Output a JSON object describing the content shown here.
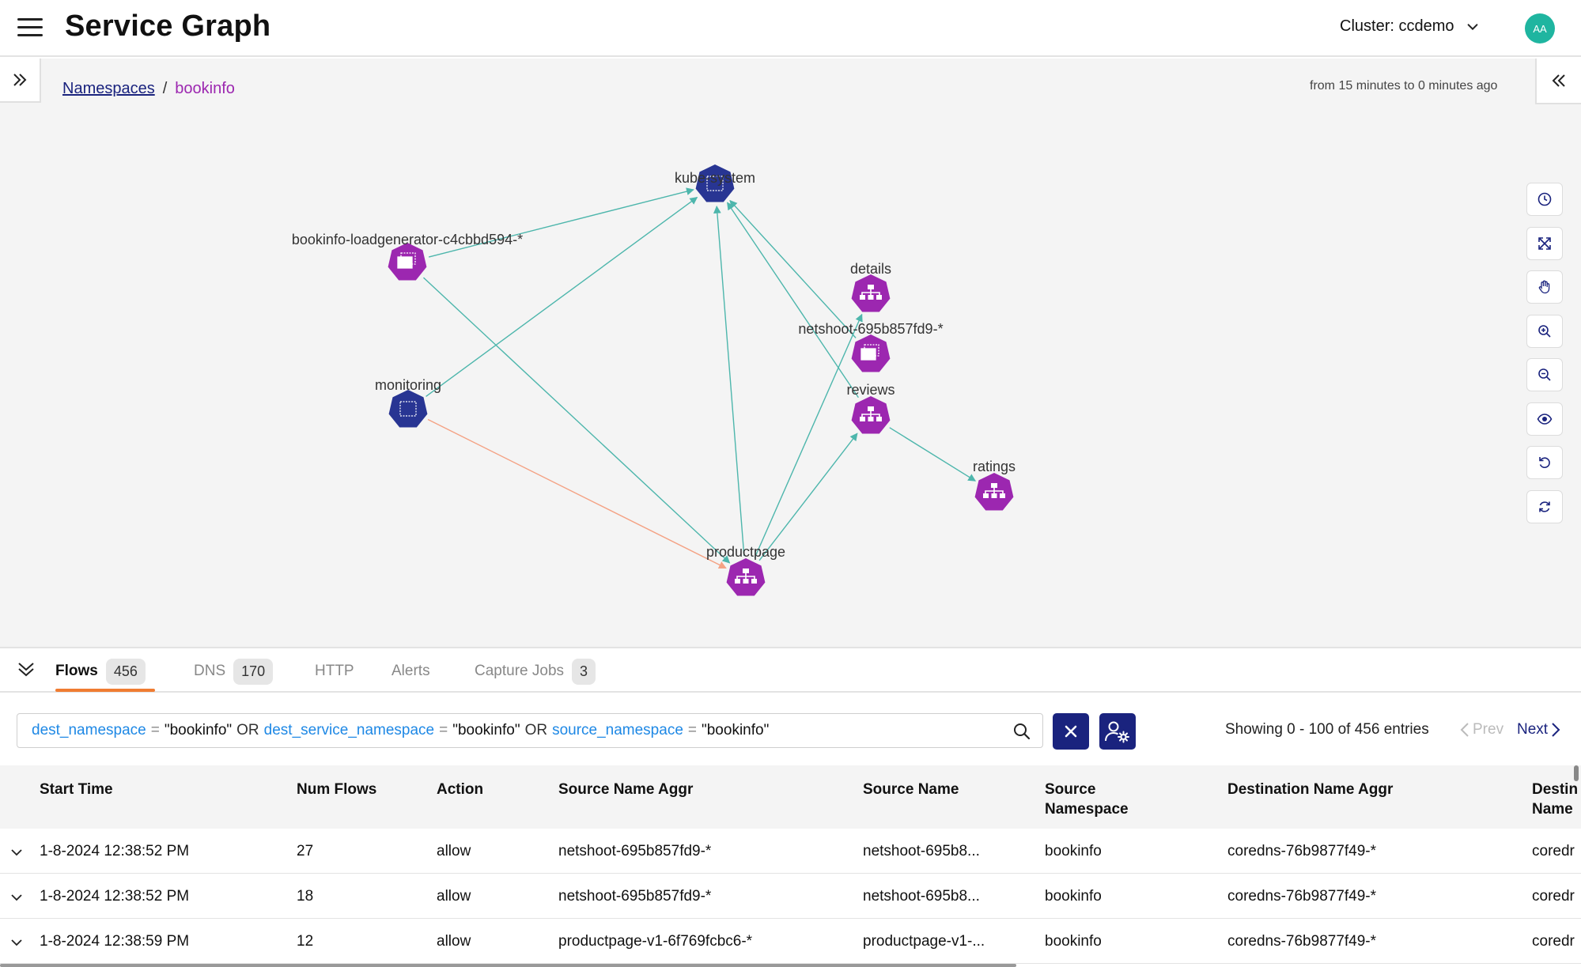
{
  "header": {
    "title": "Service Graph",
    "cluster_label": "Cluster: ccdemo",
    "avatar_initials": "AA"
  },
  "breadcrumb": {
    "root": "Namespaces",
    "separator": "/",
    "current": "bookinfo"
  },
  "time_range": "from 15 minutes to 0 minutes ago",
  "graph": {
    "node_colors": {
      "namespace": "#283593",
      "workload": "#9c27b0",
      "edge_allow": "#4db6ac",
      "edge_deny": "#f4a284"
    },
    "nodes": [
      {
        "id": "kube-system",
        "label": "kube-system",
        "kind": "namespace",
        "icon": "namespace-icon"
      },
      {
        "id": "loadgen",
        "label": "bookinfo-loadgenerator-c4cbbd594-*",
        "kind": "workload",
        "icon": "deployment-icon"
      },
      {
        "id": "details",
        "label": "details",
        "kind": "service",
        "icon": "service-icon"
      },
      {
        "id": "netshoot",
        "label": "netshoot-695b857fd9-*",
        "kind": "workload",
        "icon": "deployment-icon"
      },
      {
        "id": "monitoring",
        "label": "monitoring",
        "kind": "namespace",
        "icon": "namespace-icon"
      },
      {
        "id": "reviews",
        "label": "reviews",
        "kind": "service",
        "icon": "service-icon"
      },
      {
        "id": "ratings",
        "label": "ratings",
        "kind": "service",
        "icon": "service-icon"
      },
      {
        "id": "productpage",
        "label": "productpage",
        "kind": "service",
        "icon": "service-icon"
      }
    ],
    "edges": [
      {
        "from": "loadgen",
        "to": "kube-system",
        "type": "allow"
      },
      {
        "from": "loadgen",
        "to": "productpage",
        "type": "allow"
      },
      {
        "from": "monitoring",
        "to": "kube-system",
        "type": "allow"
      },
      {
        "from": "monitoring",
        "to": "productpage",
        "type": "deny"
      },
      {
        "from": "productpage",
        "to": "kube-system",
        "type": "allow"
      },
      {
        "from": "productpage",
        "to": "details",
        "type": "allow"
      },
      {
        "from": "productpage",
        "to": "reviews",
        "type": "allow"
      },
      {
        "from": "reviews",
        "to": "ratings",
        "type": "allow"
      },
      {
        "from": "netshoot",
        "to": "kube-system",
        "type": "allow"
      },
      {
        "from": "reviews",
        "to": "kube-system",
        "type": "allow"
      }
    ]
  },
  "tools": [
    "clock-icon",
    "fit-icon",
    "pan-icon",
    "zoom-in-icon",
    "zoom-out-icon",
    "eye-icon",
    "undo-icon",
    "refresh-icon"
  ],
  "tabs": [
    {
      "label": "Flows",
      "count": "456",
      "active": true
    },
    {
      "label": "DNS",
      "count": "170"
    },
    {
      "label": "HTTP"
    },
    {
      "label": "Alerts"
    },
    {
      "label": "Capture Jobs",
      "count": "3"
    }
  ],
  "query": {
    "parts": [
      {
        "t": "field",
        "v": "dest_namespace"
      },
      {
        "t": "op",
        "v": "="
      },
      {
        "t": "val",
        "v": "\"bookinfo\""
      },
      {
        "t": "kw",
        "v": "OR"
      },
      {
        "t": "field",
        "v": "dest_service_namespace"
      },
      {
        "t": "op",
        "v": "="
      },
      {
        "t": "val",
        "v": "\"bookinfo\""
      },
      {
        "t": "kw",
        "v": "OR"
      },
      {
        "t": "field",
        "v": "source_namespace"
      },
      {
        "t": "op",
        "v": "="
      },
      {
        "t": "val",
        "v": "\"bookinfo\""
      }
    ]
  },
  "pagination": {
    "showing": "Showing 0 - 100 of 456 entries",
    "prev": "Prev",
    "next": "Next"
  },
  "table": {
    "columns": [
      {
        "label": "Start Time"
      },
      {
        "label": "Num Flows"
      },
      {
        "label": "Action"
      },
      {
        "label": "Source Name Aggr"
      },
      {
        "label": "Source Name"
      },
      {
        "label": "Source\nNamespace"
      },
      {
        "label": "Destination Name Aggr"
      },
      {
        "label": "Destin\nName"
      }
    ],
    "rows": [
      [
        "1-8-2024 12:38:52 PM",
        "27",
        "allow",
        "netshoot-695b857fd9-*",
        "netshoot-695b8...",
        "bookinfo",
        "coredns-76b9877f49-*",
        "coredr"
      ],
      [
        "1-8-2024 12:38:52 PM",
        "18",
        "allow",
        "netshoot-695b857fd9-*",
        "netshoot-695b8...",
        "bookinfo",
        "coredns-76b9877f49-*",
        "coredr"
      ],
      [
        "1-8-2024 12:38:59 PM",
        "12",
        "allow",
        "productpage-v1-6f769fcbc6-*",
        "productpage-v1-...",
        "bookinfo",
        "coredns-76b9877f49-*",
        "coredr"
      ]
    ]
  }
}
